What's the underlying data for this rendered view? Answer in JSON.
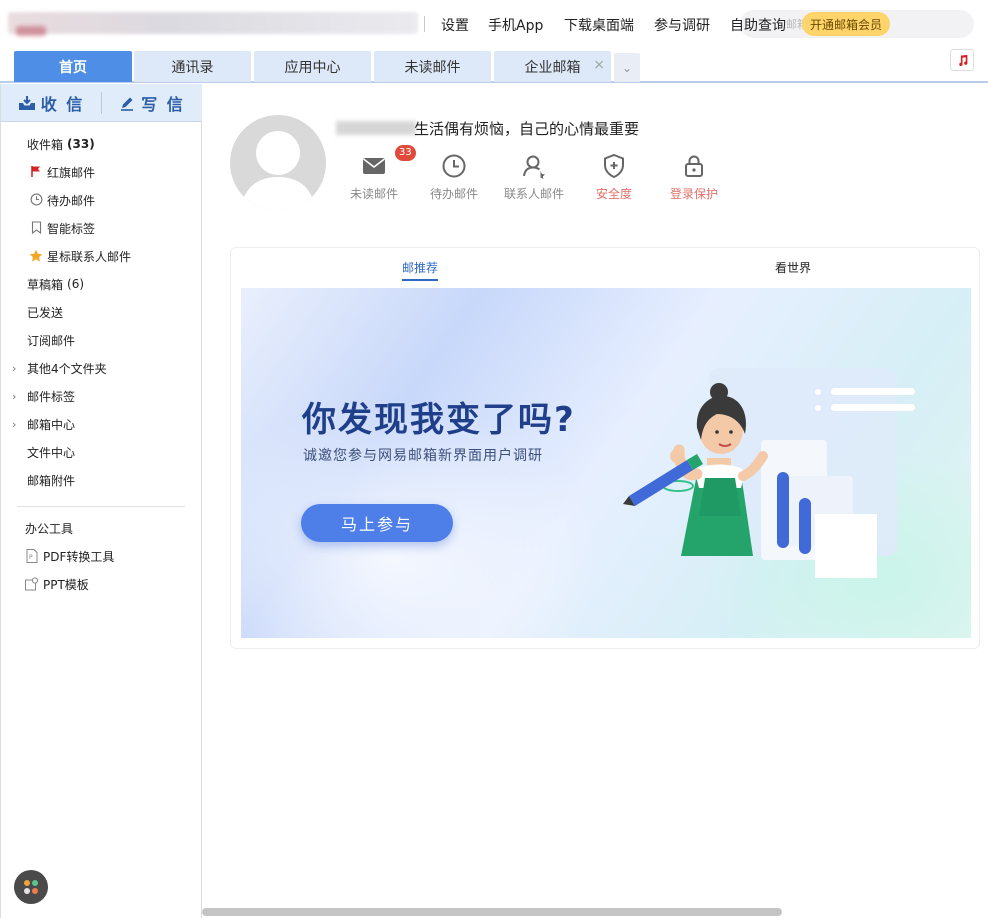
{
  "topbar": {
    "links": [
      "设置",
      "手机App",
      "下载桌面端",
      "参与调研",
      "自助查询"
    ],
    "search_hint": "邮箱",
    "vip_label": "开通邮箱会员"
  },
  "tabs": [
    {
      "label": "首页",
      "active": true
    },
    {
      "label": "通讯录"
    },
    {
      "label": "应用中心"
    },
    {
      "label": "未读邮件"
    },
    {
      "label": "企业邮箱",
      "closable": true
    }
  ],
  "tabs_close_glyph": "×",
  "tabs_more_glyph": "⌄",
  "sidebar": {
    "receive_label": "收 信",
    "compose_label": "写 信",
    "folders": [
      {
        "label": "收件箱",
        "count": "(33)",
        "icon": "none"
      },
      {
        "label": "红旗邮件",
        "icon": "red-flag-icon"
      },
      {
        "label": "待办邮件",
        "icon": "clock-icon"
      },
      {
        "label": "智能标签",
        "icon": "bookmark-icon"
      },
      {
        "label": "星标联系人邮件",
        "icon": "star-icon"
      },
      {
        "label": "草稿箱",
        "count": "(6)"
      },
      {
        "label": "已发送"
      },
      {
        "label": "订阅邮件"
      },
      {
        "label": "其他4个文件夹",
        "expandable": true
      },
      {
        "label": "邮件标签",
        "expandable": true
      },
      {
        "label": "邮箱中心",
        "expandable": true
      },
      {
        "label": "文件中心"
      },
      {
        "label": "邮箱附件"
      }
    ],
    "tools_title": "办公工具",
    "tools": [
      {
        "label": "PDF转换工具",
        "icon": "pdf-file-icon"
      },
      {
        "label": "PPT模板",
        "icon": "ppt-template-icon"
      }
    ]
  },
  "profile": {
    "greeting": "生活偶有烦恼，自己的心情最重要",
    "stats": [
      {
        "label": "未读邮件",
        "icon": "mail-icon",
        "badge": "33"
      },
      {
        "label": "待办邮件",
        "icon": "clock-icon"
      },
      {
        "label": "联系人邮件",
        "icon": "contact-icon"
      },
      {
        "label": "安全度",
        "icon": "shield-icon",
        "warning": true
      },
      {
        "label": "登录保护",
        "icon": "lock-icon",
        "warning": true
      }
    ]
  },
  "content_tabs": [
    {
      "label": "邮推荐",
      "active": true
    },
    {
      "label": "看世界"
    }
  ],
  "banner": {
    "title": "你发现我变了吗?",
    "subtitle": "诚邀您参与网易邮箱新界面用户调研",
    "cta": "马上参与"
  },
  "colors": {
    "accent": "#4f8ee6",
    "tab_inactive": "#dde9f8",
    "badge": "#e04a3b",
    "warning_text": "#e0706a",
    "vip": "#ffd46a",
    "banner_title": "#1f3f8a"
  }
}
